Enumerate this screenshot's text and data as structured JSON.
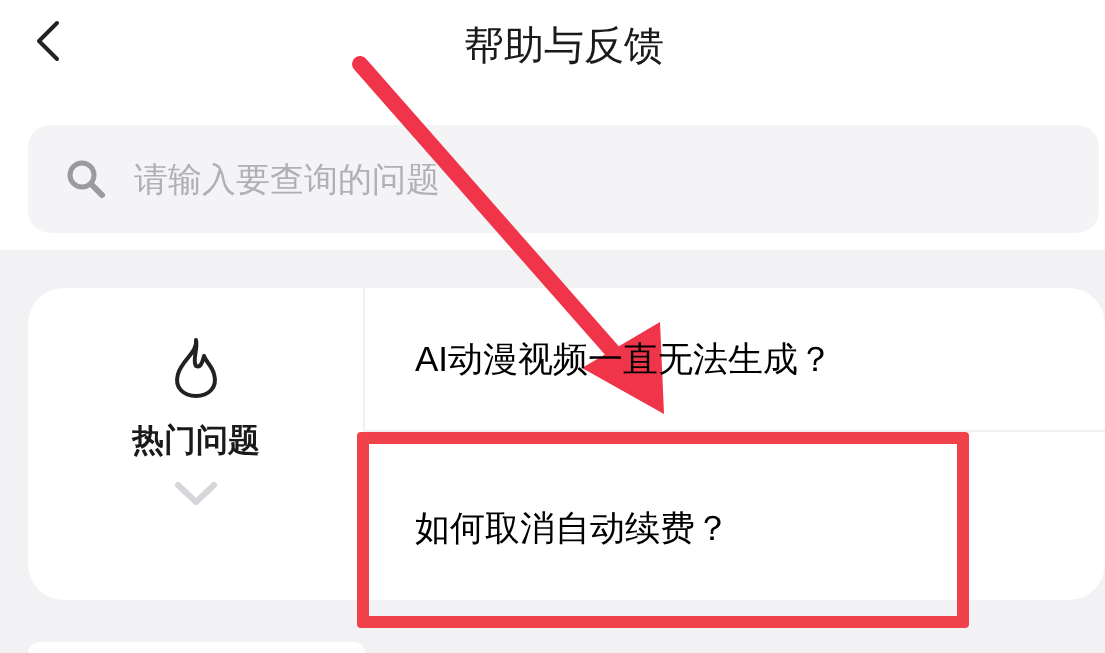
{
  "header": {
    "title": "帮助与反馈"
  },
  "search": {
    "placeholder": "请输入要查询的问题"
  },
  "hot_questions": {
    "label": "热门问题",
    "expanded": false,
    "questions": [
      {
        "text": "AI动漫视频一直无法生成？",
        "highlighted": false
      },
      {
        "text": "如何取消自动续费？",
        "highlighted": true
      }
    ]
  }
}
